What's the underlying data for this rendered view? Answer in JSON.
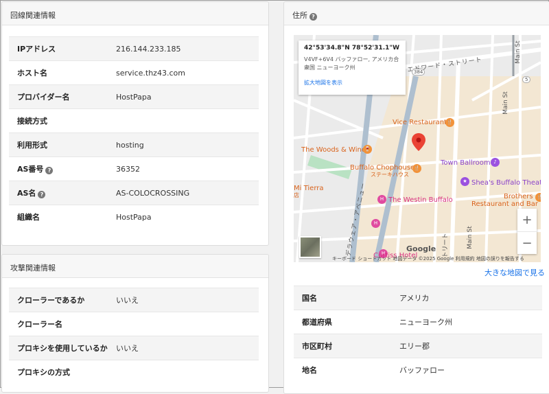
{
  "line_info": {
    "header": "回線関連情報",
    "rows": [
      {
        "key": "IPアドレス",
        "value": "216.144.233.185",
        "help": false
      },
      {
        "key": "ホスト名",
        "value": "service.thz43.com",
        "help": false
      },
      {
        "key": "プロバイダー名",
        "value": "HostPapa",
        "help": false
      },
      {
        "key": "接続方式",
        "value": "",
        "help": false
      },
      {
        "key": "利用形式",
        "value": "hosting",
        "help": false
      },
      {
        "key": "AS番号",
        "value": "36352",
        "help": true
      },
      {
        "key": "AS名",
        "value": "AS-COLOCROSSING",
        "help": true
      },
      {
        "key": "組織名",
        "value": "HostPapa",
        "help": false
      }
    ]
  },
  "attack_info": {
    "header": "攻撃関連情報",
    "rows": [
      {
        "key": "クローラーであるか",
        "value": "いいえ"
      },
      {
        "key": "クローラー名",
        "value": ""
      },
      {
        "key": "プロキシを使用しているか",
        "value": "いいえ"
      },
      {
        "key": "プロキシの方式",
        "value": ""
      }
    ]
  },
  "address": {
    "header": "住所",
    "help_icon": "question-circle-icon",
    "big_map_link": "大きな地図で見る",
    "rows": [
      {
        "key": "国名",
        "value": "アメリカ"
      },
      {
        "key": "都道府県",
        "value": "ニューヨーク州"
      },
      {
        "key": "市区町村",
        "value": "エリー郡"
      },
      {
        "key": "地名",
        "value": "バッファロー"
      }
    ]
  },
  "map": {
    "coord": "42°53'34.8\"N 78°52'31.1\"W",
    "addr_line1": "V4VF+6V4 バッファロー, アメリカ合",
    "addr_line2": "衆国 ニューヨーク州",
    "enlarge_link": "拡大地図を表示",
    "labels": {
      "vice": "Vice Restaurant",
      "woods": "The Woods & Wine",
      "chop": "Buffalo Chophouse",
      "chop_sub": "ステーキハウス",
      "town": "Town Ballroom",
      "sheas": "Shea's Buffalo Theatre",
      "brothers1": "Brothers",
      "brothers2": "Restaurant and Bar",
      "westin": "The Westin Buffalo",
      "mitierra": "Mi Tierra",
      "mitierra_sub": "店",
      "curtiss": "Curtiss Hotel",
      "street_top": "エドワード・ストリート",
      "main_top": "Main St",
      "main_right": "Main St",
      "main_bottom": "Main St",
      "delaware": "デラウェア・アベニュー",
      "street_bottom": "トリート",
      "route384": "384",
      "route5": "5"
    },
    "google": "Google",
    "zoom_in": "+",
    "zoom_out": "−",
    "attribution": "キーボード ショートカット   地図データ ©2025 Google   利用規約   地図の誤りを報告する"
  },
  "colors": {
    "accent": "#1a73e8",
    "pin_red": "#ea4335",
    "food": "#f29239",
    "hotel": "#e04ba0",
    "venue": "#9b51e0"
  }
}
